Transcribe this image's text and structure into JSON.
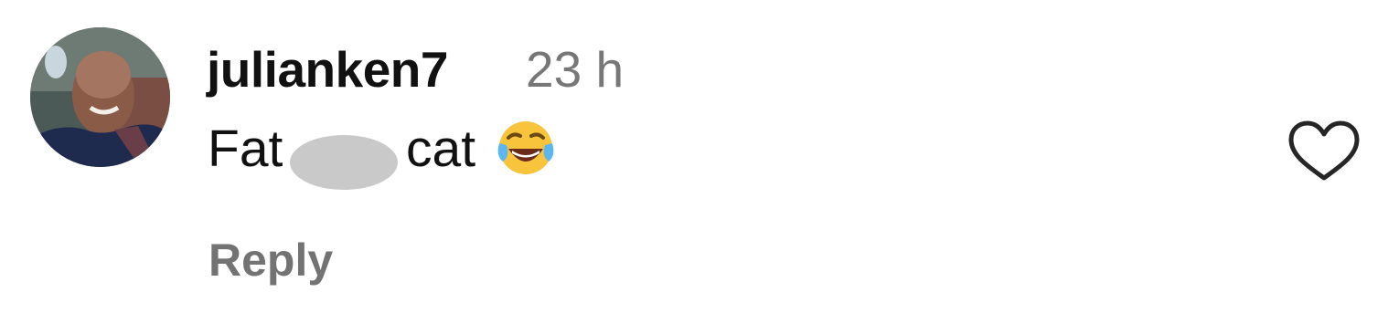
{
  "comment": {
    "username": "julianken7",
    "timestamp": "23 h",
    "text_before": "Fat",
    "text_after": "cat",
    "redaction": "redacted-word",
    "emoji": "face-with-tears-of-joy",
    "reply_label": "Reply",
    "like_icon": "heart-outline-icon",
    "avatar": "profile-photo"
  },
  "colors": {
    "username": "#111111",
    "timestamp": "#777777",
    "reply": "#737373",
    "redaction": "#c9c9c9",
    "heart_stroke": "#262626"
  }
}
